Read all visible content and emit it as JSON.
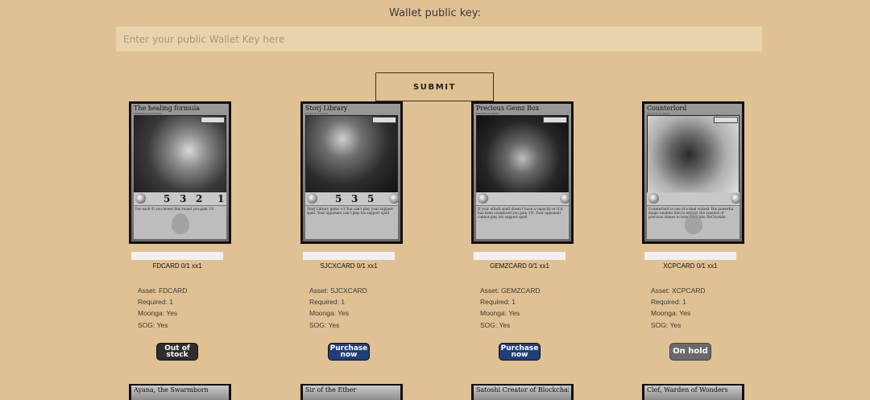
{
  "wallet": {
    "label": "Wallet public key:",
    "placeholder": "Enter your public Wallet Key here",
    "value": "",
    "submit_label": "SUBMIT"
  },
  "cards": [
    {
      "title": "The healing formula",
      "subtitle": "Manlutriegos principle",
      "stats": [
        "5",
        "3",
        "2",
        "1"
      ],
      "text": "For each © you invest this round you gain 1©",
      "name_label": "FDCARD 0/1 xx1",
      "progress": 0,
      "asset": "Asset: FDCARD",
      "required": "Required: 1",
      "moonga": "Moonga: Yes",
      "sog": "SOG: Yes",
      "button": "Out of stock",
      "button_state": "out"
    },
    {
      "title": "Storj Library",
      "subtitle": "Kingdom of Adonis",
      "stats": [
        "5",
        "3",
        "5"
      ],
      "text": "Storj Library gains +3 You can't play your support spell. Your opponent can't play his support spell",
      "name_label": "SJCXCARD 0/1 xx1",
      "progress": 0,
      "asset": "Asset: SJCXCARD",
      "required": "Required: 1",
      "moonga": "Moonga: Yes",
      "sog": "SOG: Yes",
      "button": "Purchase now",
      "button_state": "purchase"
    },
    {
      "title": "Precious Gemz Box",
      "subtitle": "Kingdom of Adonis",
      "stats": [],
      "text": "If your attack spell doesn't have a capacity or if it has been countered you gain 1©. Your opponent cannot play his support spell",
      "name_label": "GEMZCARD 0/1 xx1",
      "progress": 0,
      "asset": "Asset: GEMZCARD",
      "required": "Required: 1",
      "moonga": "Moonga: Yes",
      "sog": "SOG: Yes",
      "button": "Purchase now",
      "button_state": "purchase"
    },
    {
      "title": "Counterlord",
      "subtitle": "Kingdom of Adonis",
      "stats": [],
      "text": "Counterlord is one of a kind wizard. His powerful magic enables him to extract the essence of precious stones to turn them into XnCrystals.",
      "name_label": "XCPCARD 0/1 xx1",
      "progress": 0,
      "asset": "Asset: XCPCARD",
      "required": "Required: 1",
      "moonga": "Moonga: Yes",
      "sog": "SOG: Yes",
      "button": "On hold",
      "button_state": "hold"
    }
  ],
  "next_cards": [
    {
      "title": "Ayana, the Swarmborn"
    },
    {
      "title": "Sir of the Ether"
    },
    {
      "title": "Satoshi Creator of Blockchain"
    },
    {
      "title": "Clef, Warden of Wonders"
    }
  ]
}
